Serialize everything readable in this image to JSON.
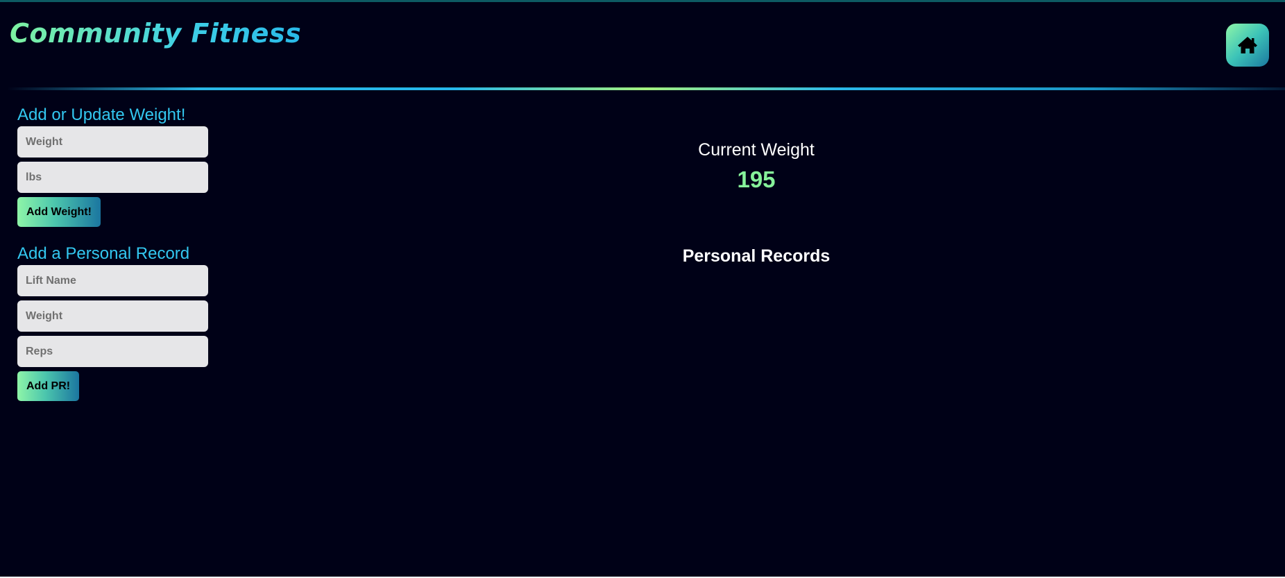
{
  "header": {
    "title": "Community Fitness",
    "home_icon": "home-icon"
  },
  "weight_form": {
    "heading": "Add or Update Weight!",
    "weight_placeholder": "Weight",
    "unit_placeholder": "lbs",
    "submit_label": "Add Weight!"
  },
  "pr_form": {
    "heading": "Add a Personal Record",
    "lift_placeholder": "Lift Name",
    "weight_placeholder": "Weight",
    "reps_placeholder": "Reps",
    "submit_label": "Add PR!"
  },
  "summary": {
    "current_weight_label": "Current Weight",
    "current_weight_value": "195",
    "personal_records_label": "Personal Records"
  },
  "colors": {
    "background": "#000117",
    "accent_heading": "#33c8f0",
    "weight_value": "#86f29a"
  }
}
